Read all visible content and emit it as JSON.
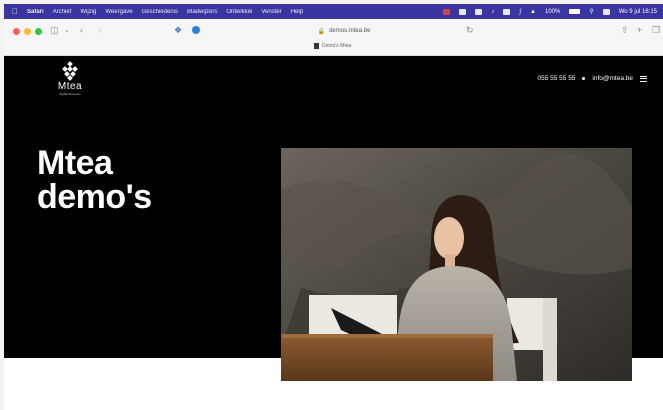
{
  "menubar": {
    "app": "Safari",
    "menus": [
      "Archief",
      "Wijzig",
      "Weergave",
      "Geschiedenis",
      "Bladwijzers",
      "Ontwikkel",
      "Venster",
      "Help"
    ],
    "clock": "Wo 9 jul 16:15",
    "battery": "100%"
  },
  "browser": {
    "url": "demos.mtea.be",
    "tab_title": "Demo's Mtea"
  },
  "site": {
    "logo_name": "Mtea",
    "logo_tagline": "Digital Business",
    "phone": "055 55 55 55",
    "email": "info@mtea.be",
    "headline_line1": "Mtea",
    "headline_line2": "demo's"
  },
  "colors": {
    "menubar": "#3a35a0",
    "hero_bg": "#000000",
    "text": "#ffffff"
  }
}
